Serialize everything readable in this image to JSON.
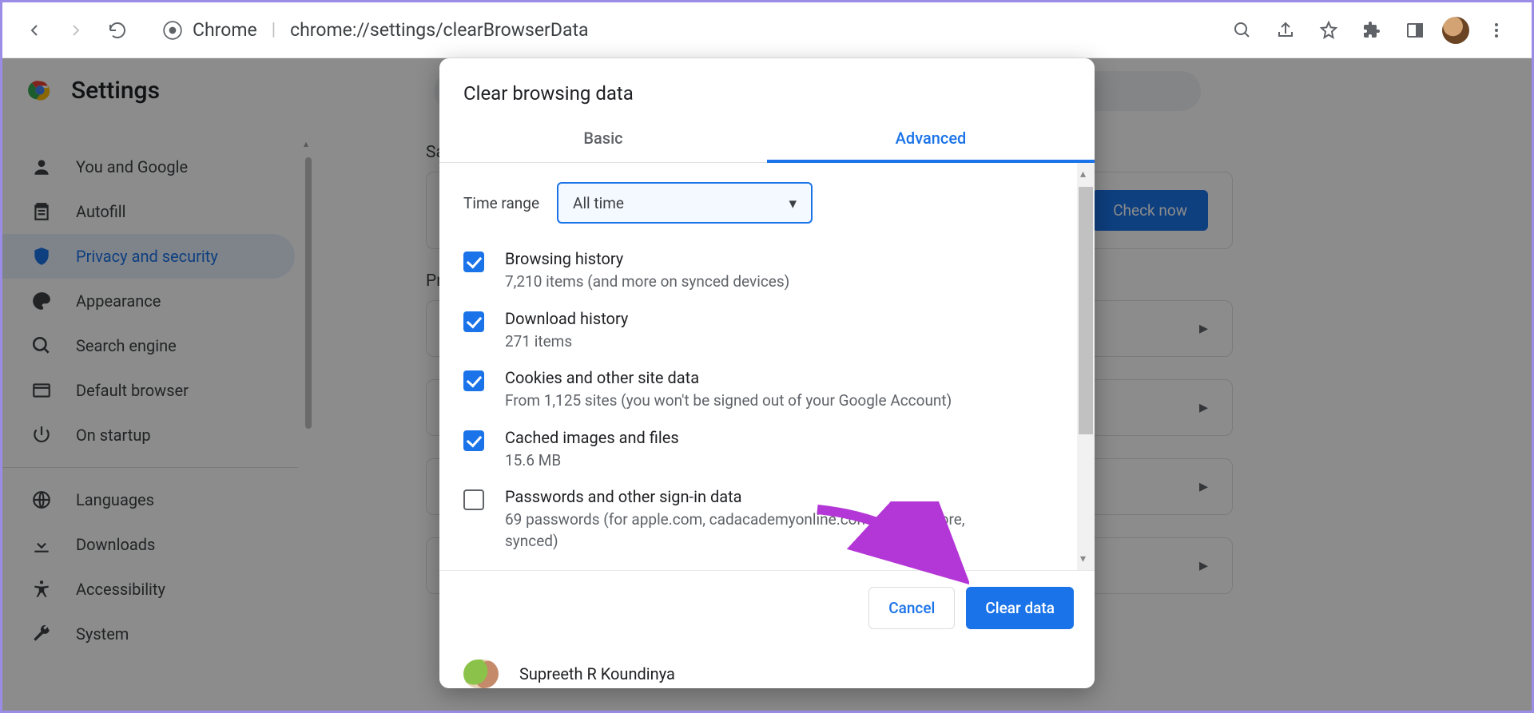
{
  "browser": {
    "label": "Chrome",
    "url": "chrome://settings/clearBrowserData"
  },
  "settings": {
    "title": "Settings",
    "sidebar": [
      {
        "label": "You and Google",
        "icon": "person"
      },
      {
        "label": "Autofill",
        "icon": "autofill"
      },
      {
        "label": "Privacy and security",
        "icon": "shield"
      },
      {
        "label": "Appearance",
        "icon": "palette"
      },
      {
        "label": "Search engine",
        "icon": "search"
      },
      {
        "label": "Default browser",
        "icon": "browser"
      },
      {
        "label": "On startup",
        "icon": "power"
      },
      {
        "label": "Languages",
        "icon": "globe"
      },
      {
        "label": "Downloads",
        "icon": "download"
      },
      {
        "label": "Accessibility",
        "icon": "accessibility"
      },
      {
        "label": "System",
        "icon": "wrench"
      }
    ],
    "section_safety": "Saf",
    "section_privacy": "Priv",
    "check_now": "Check now"
  },
  "dialog": {
    "title": "Clear browsing data",
    "tabs": {
      "basic": "Basic",
      "advanced": "Advanced"
    },
    "time_range_label": "Time range",
    "time_range_value": "All time",
    "items": [
      {
        "checked": true,
        "title": "Browsing history",
        "sub": "7,210 items (and more on synced devices)"
      },
      {
        "checked": true,
        "title": "Download history",
        "sub": "271 items"
      },
      {
        "checked": true,
        "title": "Cookies and other site data",
        "sub": "From 1,125 sites (you won't be signed out of your Google Account)"
      },
      {
        "checked": true,
        "title": "Cached images and files",
        "sub": "15.6 MB"
      },
      {
        "checked": false,
        "title": "Passwords and other sign-in data",
        "sub": "69 passwords (for apple.com, cadacademyonline.com, and 67 more, synced)"
      }
    ],
    "cancel": "Cancel",
    "clear": "Clear data",
    "user_name": "Supreeth R Koundinya"
  }
}
